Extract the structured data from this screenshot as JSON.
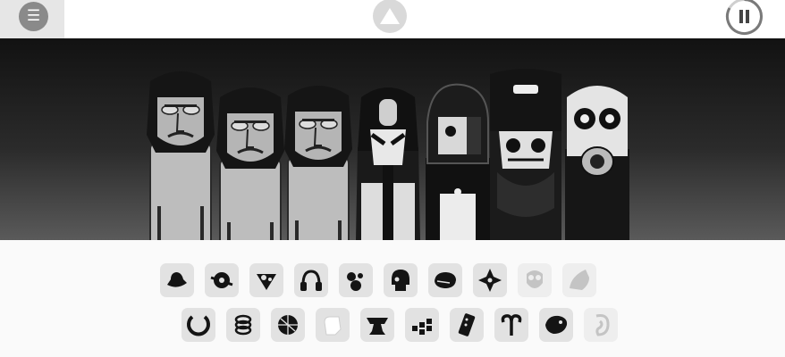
{
  "topbar": {
    "menu_glyph": "☰",
    "menu_icon": "menu-icon",
    "logo_icon": "triangle-logo-icon",
    "pause_icon": "pause-icon"
  },
  "stage": {
    "characters": [
      {
        "name": "character-1",
        "type": "beat"
      },
      {
        "name": "character-2",
        "type": "beat"
      },
      {
        "name": "character-3",
        "type": "beat"
      },
      {
        "name": "character-4",
        "type": "effects"
      },
      {
        "name": "character-5",
        "type": "effects"
      },
      {
        "name": "character-6",
        "type": "melody"
      },
      {
        "name": "character-7",
        "type": "voice"
      }
    ],
    "loop_progress": [
      {
        "character": 4,
        "fraction": 0.3
      },
      {
        "character": 5,
        "fraction": 0.35
      },
      {
        "character": 7,
        "fraction": 0.45
      }
    ]
  },
  "tray": {
    "row1": [
      "hat-icon",
      "disc-icon",
      "dots-icon",
      "headphones-icon",
      "bubbles-icon",
      "skull-icon",
      "cap-icon",
      "cross-icon",
      "gasmask-icon",
      "hood-icon"
    ],
    "row2": [
      "ring-icon",
      "coil-icon",
      "globe-icon",
      "glove-icon",
      "anvil-icon",
      "keys-icon",
      "remote-icon",
      "aries-icon",
      "fish-icon",
      "ear-icon"
    ],
    "row1_disabled": [
      8,
      9
    ],
    "row2_disabled": [
      9
    ],
    "colors": {
      "icon": "#141414",
      "disabled_icon": "#c4c4c4",
      "slot": "#e2e2e2"
    }
  }
}
